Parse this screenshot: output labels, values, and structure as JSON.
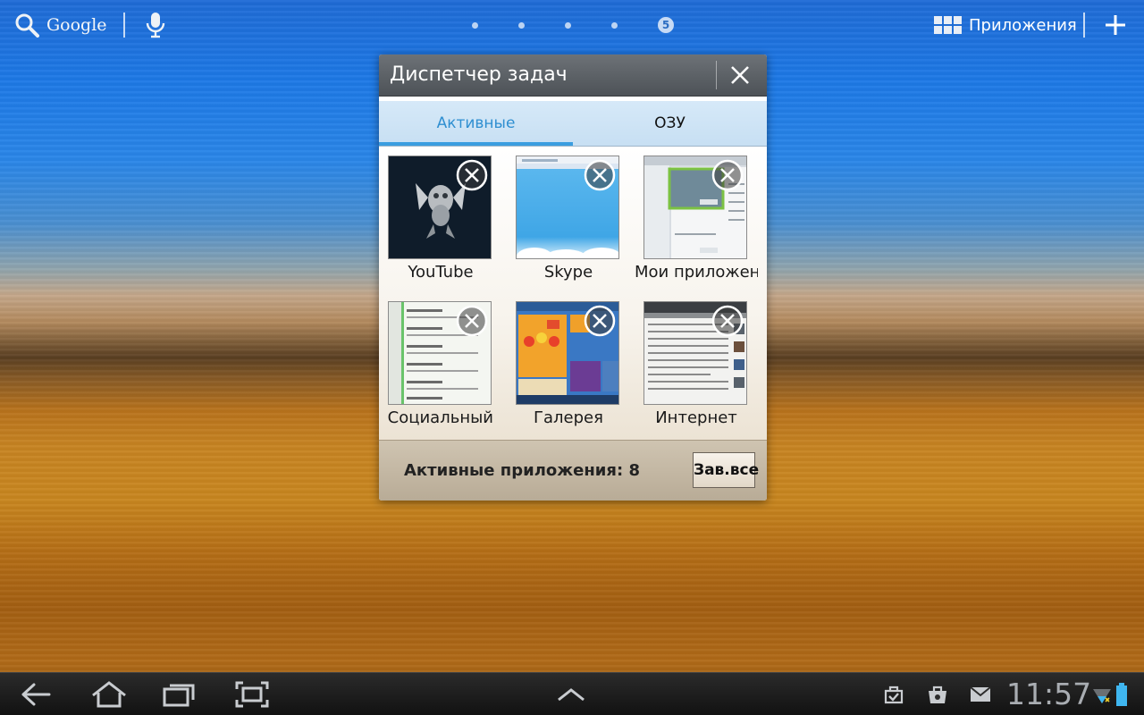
{
  "topbar": {
    "search_label": "Google",
    "apps_label": "Приложения",
    "current_page": "5"
  },
  "dialog": {
    "title": "Диспетчер задач",
    "tabs": [
      {
        "label": "Активные",
        "selected": true
      },
      {
        "label": "ОЗУ",
        "selected": false
      }
    ],
    "apps": [
      {
        "label": "YouTube",
        "icon": "youtube-thumbnail"
      },
      {
        "label": "Skype",
        "icon": "skype-thumbnail"
      },
      {
        "label": "Мои приложения",
        "icon": "my-apps-thumbnail"
      },
      {
        "label": "Социальный",
        "icon": "social-hub-thumbnail"
      },
      {
        "label": "Галерея",
        "icon": "gallery-thumbnail"
      },
      {
        "label": "Интернет",
        "icon": "internet-thumbnail"
      }
    ],
    "footer_text": "Активные приложения: 8",
    "close_all_label": "Зав.все"
  },
  "sysbar": {
    "clock": "11:57"
  },
  "colors": {
    "accent_tab": "#3a9ee0",
    "battery": "#3fb6f0"
  }
}
